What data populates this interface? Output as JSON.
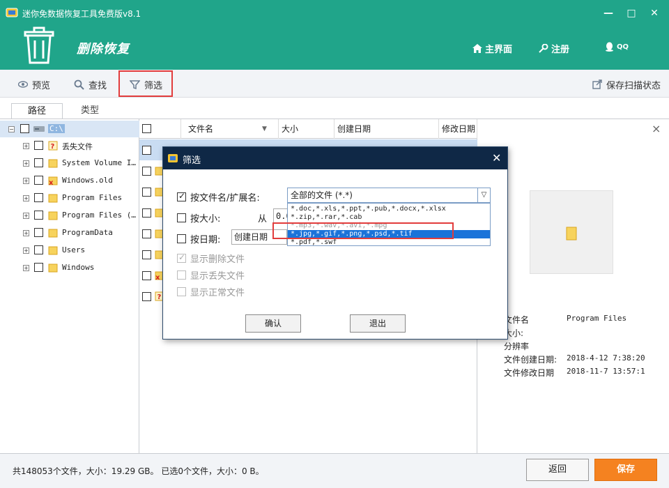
{
  "window": {
    "title": "迷你免数据恢复工具免费版v8.1",
    "minimize": "—",
    "maximize": "□",
    "close": "✕"
  },
  "header": {
    "subtitle": "删除恢复",
    "nav": {
      "home": "主界面",
      "register": "注册",
      "qq": "QQ"
    }
  },
  "toolbar": {
    "preview": "预览",
    "search": "查找",
    "filter": "筛选",
    "save_state": "保存扫描状态"
  },
  "left_tabs": {
    "path": "路径",
    "type": "类型"
  },
  "tree": [
    {
      "label": "C:\\",
      "kind": "drive"
    },
    {
      "label": "丢失文件",
      "kind": "lost"
    },
    {
      "label": "System Volume I…",
      "kind": "folder"
    },
    {
      "label": "Windows.old",
      "kind": "deleted"
    },
    {
      "label": "Program Files",
      "kind": "folder"
    },
    {
      "label": "Program Files (…",
      "kind": "folder"
    },
    {
      "label": "ProgramData",
      "kind": "folder"
    },
    {
      "label": "Users",
      "kind": "folder"
    },
    {
      "label": "Windows",
      "kind": "folder"
    }
  ],
  "filelist": {
    "columns": {
      "name": "文件名",
      "size": "大小",
      "created": "创建日期",
      "modified": "修改日期"
    }
  },
  "preview": {
    "close": "×",
    "rows": [
      {
        "key": "文件名",
        "value": "Program Files"
      },
      {
        "key": "大小:",
        "value": ""
      },
      {
        "key": "分辨率",
        "value": ""
      },
      {
        "key": "文件创建日期:",
        "value": "2018-4-12 7:38:20"
      },
      {
        "key": "文件修改日期",
        "value": "2018-11-7 13:57:1"
      }
    ]
  },
  "status": {
    "summary": "共148053个文件，大小：19.29 GB。 已选0个文件，大小：0 B。"
  },
  "buttons": {
    "back": "返回",
    "save": "保存"
  },
  "dialog": {
    "title": "筛选",
    "close": "✕",
    "by_name_label": "按文件名/扩展名:",
    "by_name_value": "全部的文件 (*.*)",
    "dropdown_options": [
      "*.doc,*.xls,*.ppt,*.pub,*.docx,*.xlsx",
      "*.zip,*.rar,*.cab",
      "*.mp3,*.wav,*.avi,*.mpg",
      "*.jpg,*.gif,*.png,*.psd,*.tif",
      "*.pdf,*.swf"
    ],
    "selected_option_index": 3,
    "by_size_label": "按大小:",
    "from_label": "从",
    "size_from_value": "0.0",
    "by_date_label": "按日期:",
    "date_type_value": "创建日期",
    "show_deleted": "显示删除文件",
    "show_lost": "显示丢失文件",
    "show_normal": "显示正常文件",
    "confirm": "确认",
    "exit": "退出"
  },
  "colors": {
    "header": "#20a58a",
    "accent_orange": "#f58220",
    "highlight_red": "#e23c3c",
    "dialog_title": "#0f2846",
    "selection_blue": "#1a73d9"
  }
}
